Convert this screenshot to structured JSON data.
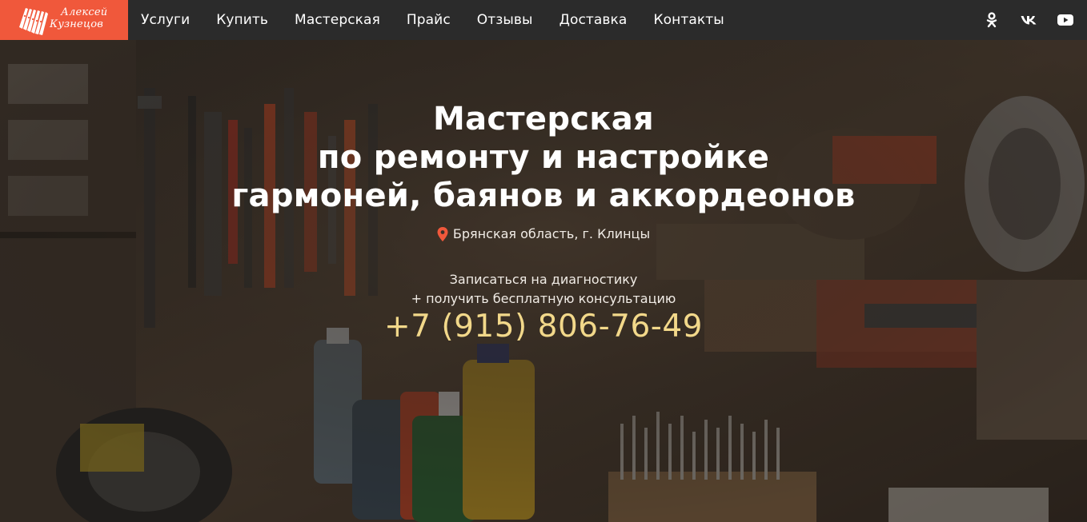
{
  "brand": {
    "logo_line1": "Алексей",
    "logo_line2": "Кузнецов",
    "accent_color": "#f0583b",
    "header_color": "#2b2b2b",
    "logo_icon": "accordion-icon"
  },
  "nav": {
    "items": [
      {
        "label": "Услуги"
      },
      {
        "label": "Купить"
      },
      {
        "label": "Мастерская"
      },
      {
        "label": "Прайс"
      },
      {
        "label": "Отзывы"
      },
      {
        "label": "Доставка"
      },
      {
        "label": "Контакты"
      }
    ]
  },
  "socials": [
    {
      "icon": "odnoklassniki-icon"
    },
    {
      "icon": "vk-icon"
    },
    {
      "icon": "youtube-icon"
    }
  ],
  "hero": {
    "title_line1": "Мастерская",
    "title_line2": "по ремонту и настройке",
    "title_line3": "гармоней, баянов и аккордеонов",
    "location": "Брянская область, г. Клинцы",
    "location_icon": "map-pin-icon",
    "location_icon_color": "#f0583b",
    "cta_line1": "Записаться на диагностику",
    "cta_line2": "+ получить бесплатную консультацию",
    "phone": "+7 (915) 806-76-49",
    "phone_color": "#f2d88a",
    "background": "workshop-tools-photo"
  }
}
